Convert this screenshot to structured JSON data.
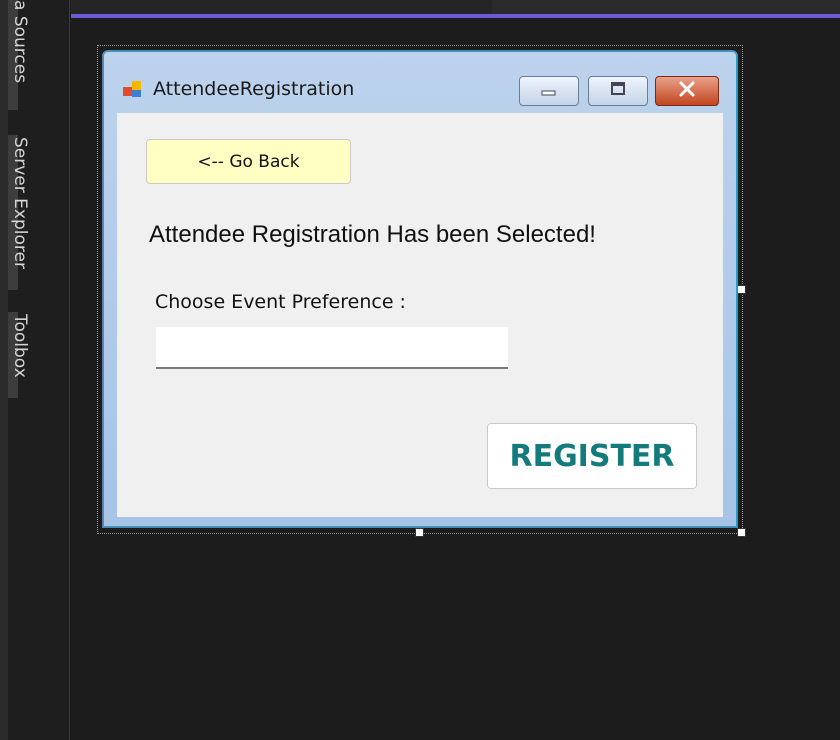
{
  "sidebar": {
    "tabs": [
      {
        "label": "a Sources"
      },
      {
        "label": "Server Explorer"
      },
      {
        "label": "Toolbox"
      }
    ]
  },
  "colors": {
    "accent": "#6a5cd8",
    "go_back_bg": "#ffffc4",
    "register_text": "#137b7b"
  },
  "form": {
    "title": "AttendeeRegistration",
    "icon": "winforms-app-icon",
    "controls": {
      "minimize_icon": "minimize-icon",
      "maximize_icon": "maximize-icon",
      "close_icon": "close-icon"
    },
    "go_back_label": "<-- Go Back",
    "heading": "Attendee Registration Has been Selected!",
    "preference_label": "Choose Event Preference :",
    "preference_value": "",
    "register_label": "REGISTER"
  }
}
